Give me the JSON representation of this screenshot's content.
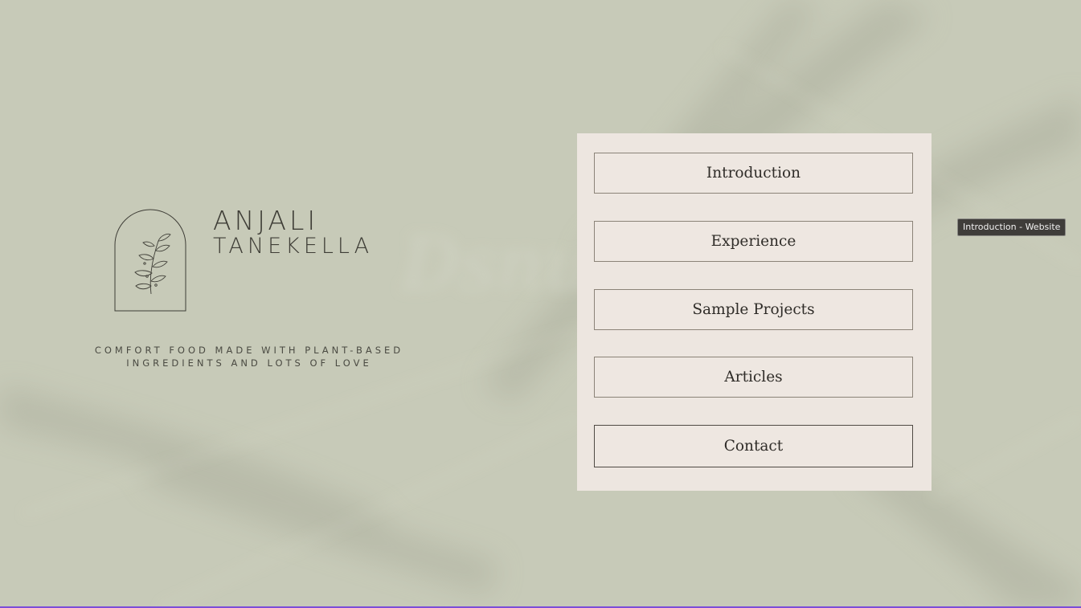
{
  "brand": {
    "first_name": "ANJALI",
    "last_name": "TANEKELLA",
    "tagline_line1": "COMFORT FOOD MADE WITH PLANT-BASED",
    "tagline_line2": "INGREDIENTS AND LOTS OF LOVE",
    "logo_icon": "leaf-branch-arch-icon"
  },
  "nav": {
    "items": [
      {
        "label": "Introduction"
      },
      {
        "label": "Experience"
      },
      {
        "label": "Sample Projects"
      },
      {
        "label": "Articles"
      },
      {
        "label": "Contact"
      }
    ]
  },
  "tooltip": {
    "text": "Introduction - Website"
  },
  "colors": {
    "background": "#c7cab8",
    "panel": "#ede6e0",
    "text": "#2f2c28",
    "border": "#8b8378"
  }
}
